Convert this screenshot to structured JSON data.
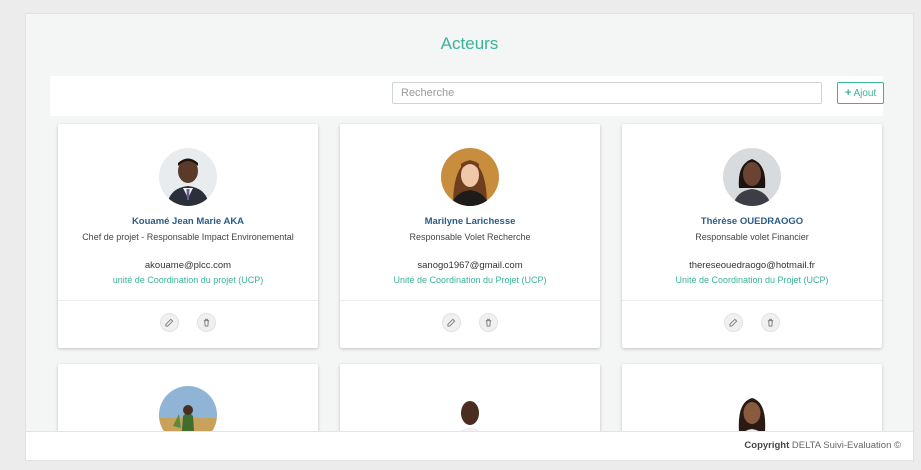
{
  "page": {
    "title": "Acteurs"
  },
  "toolbar": {
    "search_placeholder": "Recherche",
    "add_label": "Ajout"
  },
  "actors": [
    {
      "name": "Kouamé Jean Marie AKA",
      "role": "Chef de projet - Responsable Impact Environemental",
      "email": "akouame@plcc.com",
      "unit": "unité de Coordination du projet (UCP)"
    },
    {
      "name": "Marilyne Larichesse",
      "role": "Responsable Volet Recherche",
      "email": "sanogo1967@gmail.com",
      "unit": "Unité de Coordination du Projet (UCP)"
    },
    {
      "name": "Thérèse OUEDRAOGO",
      "role": "Responsable volet Financier",
      "email": "thereseouedraogo@hotmail.fr",
      "unit": "Unité de Coordination du Projet (UCP)"
    }
  ],
  "footer": {
    "copyright_label": "Copyright",
    "brand": "DELTA Suivi-Evaluation ©"
  },
  "colors": {
    "accent": "#3bb39a",
    "name": "#2a5d86"
  }
}
